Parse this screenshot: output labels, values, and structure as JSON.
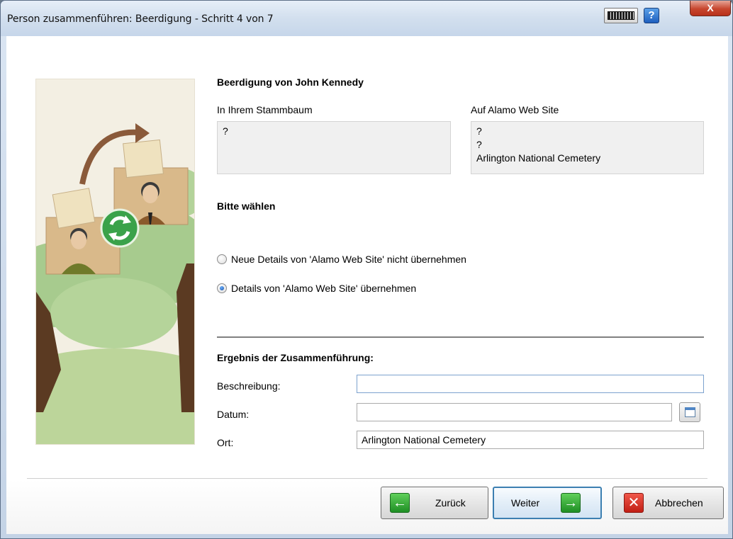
{
  "window": {
    "title": "Person zusammenführen: Beerdigung - Schritt 4 von 7",
    "help_label": "?",
    "close_label": "X"
  },
  "event_heading": "Beerdigung von John Kennedy",
  "compare": {
    "left_label": "In Ihrem Stammbaum",
    "left_lines": [
      "?"
    ],
    "right_label": "Auf Alamo Web Site",
    "right_lines": [
      "?",
      "?",
      "Arlington National Cemetery"
    ]
  },
  "choose_heading": "Bitte wählen",
  "options": [
    {
      "label": "Neue Details von 'Alamo Web Site' nicht übernehmen",
      "selected": false
    },
    {
      "label": "Details von 'Alamo Web Site' übernehmen",
      "selected": true
    }
  ],
  "result": {
    "heading": "Ergebnis der Zusammenführung:",
    "description_label": "Beschreibung:",
    "description_value": "",
    "date_label": "Datum:",
    "date_value": "",
    "place_label": "Ort:",
    "place_value": "Arlington National Cemetery"
  },
  "buttons": {
    "back_label": "Zurück",
    "next_label": "Weiter",
    "cancel_label": "Abbrechen"
  },
  "colors": {
    "accent": "#3c7fb1",
    "green_icon": "#2f9e33",
    "red_icon": "#d22b1f"
  }
}
